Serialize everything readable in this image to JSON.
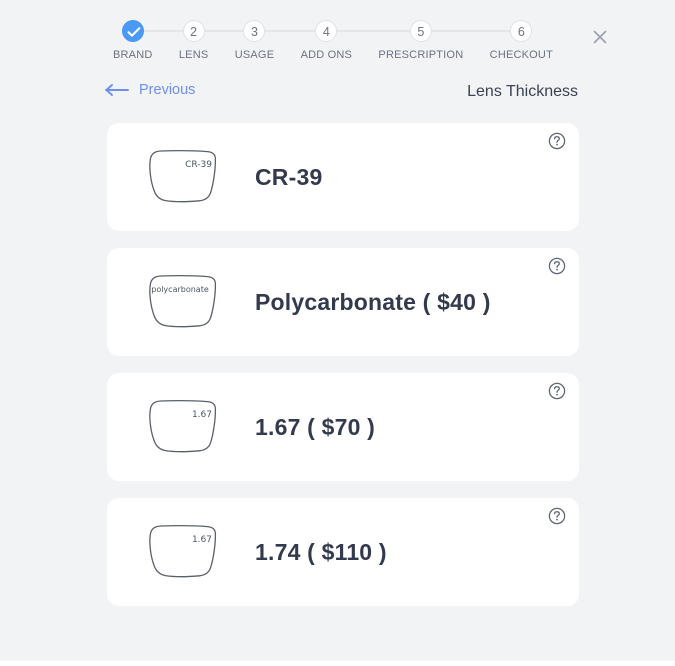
{
  "header": {
    "close_icon": "close-icon",
    "steps": [
      {
        "number": "1",
        "label": "BRAND",
        "state": "done"
      },
      {
        "number": "2",
        "label": "LENS",
        "state": "todo"
      },
      {
        "number": "3",
        "label": "USAGE",
        "state": "todo"
      },
      {
        "number": "4",
        "label": "ADD ONS",
        "state": "todo"
      },
      {
        "number": "5",
        "label": "PRESCRIPTION",
        "state": "todo"
      },
      {
        "number": "6",
        "label": "CHECKOUT",
        "state": "todo"
      }
    ]
  },
  "nav": {
    "previous_label": "Previous",
    "previous_icon": "arrow-left-icon",
    "title": "Lens Thickness"
  },
  "options": [
    {
      "title": "CR-39",
      "lens_caption": "CR-39",
      "caption_style": "short",
      "help_icon": "help-circle-icon"
    },
    {
      "title": "Polycarbonate ( $40 )",
      "lens_caption": "polycarbonate",
      "caption_style": "wide",
      "help_icon": "help-circle-icon"
    },
    {
      "title": "1.67 ( $70 )",
      "lens_caption": "1.67",
      "caption_style": "short",
      "help_icon": "help-circle-icon"
    },
    {
      "title": "1.74 ( $110 )",
      "lens_caption": "1.67",
      "caption_style": "short",
      "help_icon": "help-circle-icon"
    }
  ],
  "colors": {
    "background": "#f2f3f5",
    "card": "#ffffff",
    "accent_blue": "#4a9af5",
    "link_blue": "#6f8ff0",
    "title_dark": "#333a4d",
    "muted": "#6b7280",
    "line": "#e3e5e9"
  }
}
